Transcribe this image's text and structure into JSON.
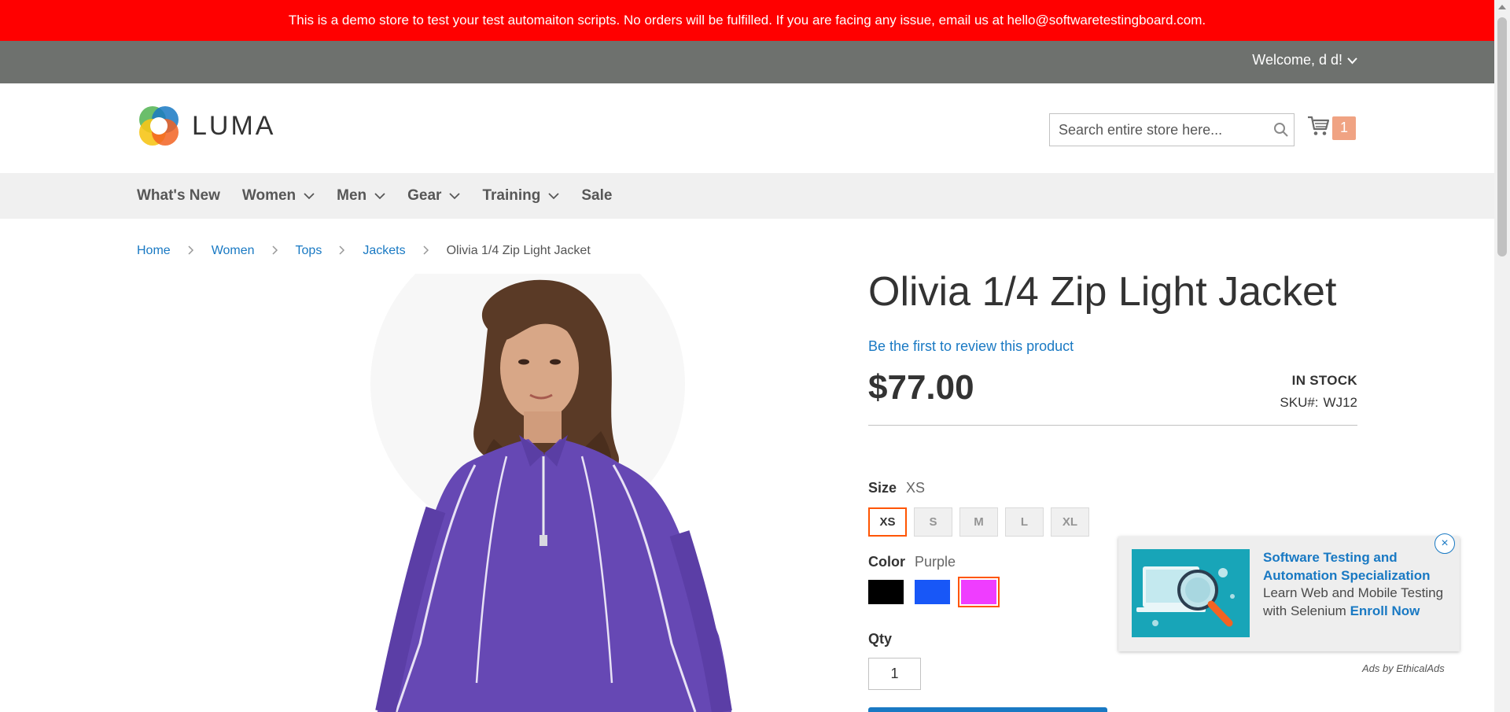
{
  "demo_notice": "This is a demo store to test your test automaiton scripts. No orders will be fulfilled. If you are facing any issue, email us at hello@softwaretestingboard.com.",
  "header": {
    "welcome": "Welcome, d d!",
    "logo_text": "LUMA",
    "search_placeholder": "Search entire store here...",
    "cart_count": "1"
  },
  "nav": {
    "items": [
      {
        "label": "What's New",
        "has_dropdown": false
      },
      {
        "label": "Women",
        "has_dropdown": true
      },
      {
        "label": "Men",
        "has_dropdown": true
      },
      {
        "label": "Gear",
        "has_dropdown": true
      },
      {
        "label": "Training",
        "has_dropdown": true
      },
      {
        "label": "Sale",
        "has_dropdown": false
      }
    ]
  },
  "breadcrumbs": [
    "Home",
    "Women",
    "Tops",
    "Jackets"
  ],
  "breadcrumb_current": "Olivia 1/4 Zip Light Jacket",
  "product": {
    "title": "Olivia 1/4 Zip Light Jacket",
    "review_link": "Be the first to review this product",
    "price": "$77.00",
    "stock": "IN STOCK",
    "sku_label": "SKU#:",
    "sku": "WJ12",
    "size_label": "Size",
    "size_selected": "XS",
    "sizes": [
      "XS",
      "S",
      "M",
      "L",
      "XL"
    ],
    "color_label": "Color",
    "color_selected": "Purple",
    "colors": [
      {
        "name": "Black",
        "hex": "#000000"
      },
      {
        "name": "Blue",
        "hex": "#1857f7"
      },
      {
        "name": "Purple",
        "hex": "#ef3dff"
      }
    ],
    "qty_label": "Qty",
    "qty": "1"
  },
  "ad": {
    "title": "Software Testing and Automation Specialization",
    "body": "Learn Web and Mobile Testing with Selenium",
    "cta": "Enroll Now",
    "close": "×",
    "attribution": "Ads by EthicalAds"
  },
  "colors": {
    "notice_bg": "#ff0000",
    "welcome_bg": "#6e716e",
    "link": "#1979c3",
    "accent": "#ff5501",
    "nav_bg": "#f0f0f0"
  }
}
